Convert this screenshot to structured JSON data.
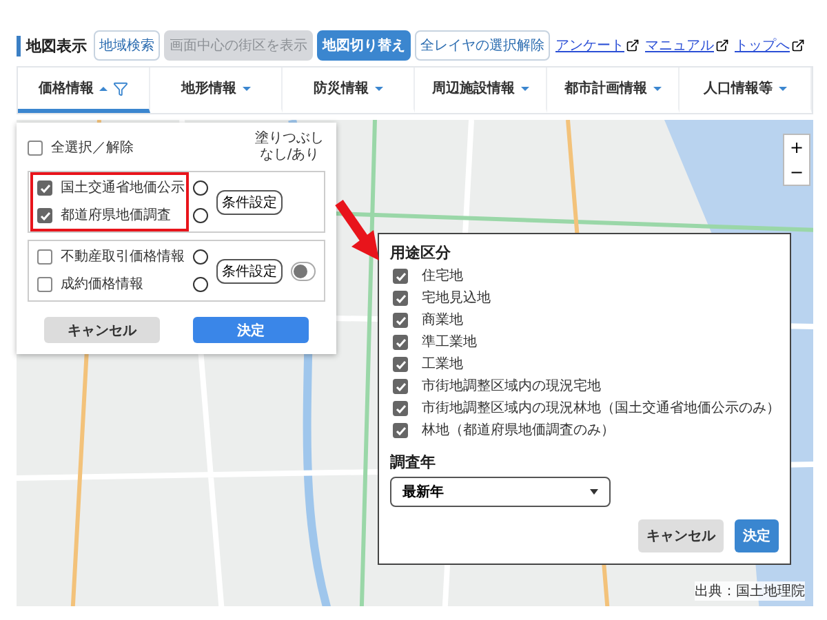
{
  "toolbar": {
    "title": "地図表示",
    "buttons": [
      {
        "label": "地域検索",
        "kind": "outline"
      },
      {
        "label": "画面中心の街区を表示",
        "kind": "disabled"
      },
      {
        "label": "地図切り替え",
        "kind": "primary"
      },
      {
        "label": "全レイヤの選択解除",
        "kind": "outline"
      }
    ],
    "links": [
      "アンケート",
      "マニュアル",
      "トップへ"
    ]
  },
  "tabs": [
    {
      "label": "価格情報",
      "selected": true,
      "filter": true
    },
    {
      "label": "地形情報",
      "selected": false
    },
    {
      "label": "防災情報",
      "selected": false
    },
    {
      "label": "周辺施設情報",
      "selected": false
    },
    {
      "label": "都市計画情報",
      "selected": false
    },
    {
      "label": "人口情報等",
      "selected": false
    }
  ],
  "layer_panel": {
    "select_all": {
      "label": "全選択／解除",
      "checked": false
    },
    "fill_label": "塗りつぶしなし/あり",
    "groups": [
      {
        "settings_button": "条件設定",
        "highlighted": true,
        "items": [
          {
            "label": "国土交通省地価公示",
            "checked": true
          },
          {
            "label": "都道府県地価調査",
            "checked": true
          }
        ]
      },
      {
        "settings_button": "条件設定",
        "highlighted": false,
        "fill_on": false,
        "items": [
          {
            "label": "不動産取引価格情報",
            "checked": false
          },
          {
            "label": "成約価格情報",
            "checked": false
          }
        ]
      }
    ],
    "buttons": [
      "キャンセル",
      "決定"
    ]
  },
  "conditions_dialog": {
    "section_title": "用途区分",
    "items": [
      {
        "label": "住宅地",
        "checked": true
      },
      {
        "label": "宅地見込地",
        "checked": true
      },
      {
        "label": "商業地",
        "checked": true
      },
      {
        "label": "準工業地",
        "checked": true
      },
      {
        "label": "工業地",
        "checked": true
      },
      {
        "label": "市街地調整区域内の現況宅地",
        "checked": true
      },
      {
        "label": "市街地調整区域内の現況林地（国土交通省地価公示のみ）",
        "checked": true
      },
      {
        "label": "林地（都道府県地価調査のみ）",
        "checked": true
      }
    ],
    "year_title": "調査年",
    "year_value": "最新年",
    "buttons": [
      "キャンセル",
      "決定"
    ]
  },
  "map": {
    "zoom_buttons": [
      "+",
      "−"
    ],
    "attribution": "出典：国土地理院"
  }
}
